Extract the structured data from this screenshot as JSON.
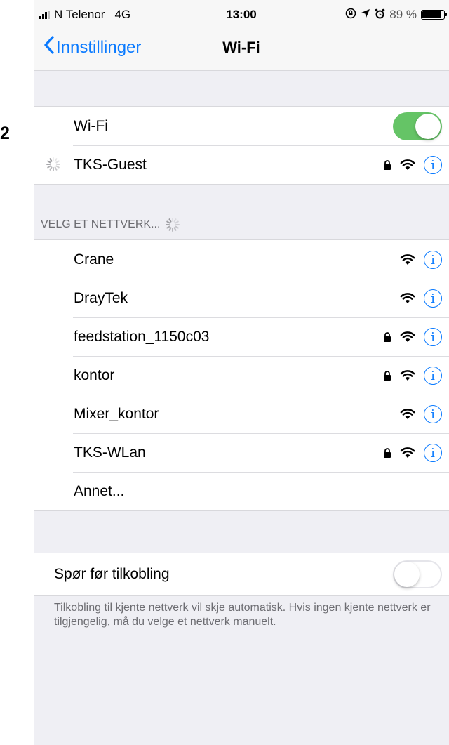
{
  "step_number": "2",
  "status_bar": {
    "carrier": "N Telenor",
    "network": "4G",
    "time": "13:00",
    "battery_text": "89 %",
    "battery_level": 0.89
  },
  "nav": {
    "back_label": "Innstillinger",
    "title": "Wi-Fi"
  },
  "wifi_toggle": {
    "label": "Wi-Fi",
    "on": true
  },
  "connected_network": {
    "name": "TKS-Guest",
    "locked": true,
    "connecting": true
  },
  "section_header": "VELG ET NETTVERK...",
  "networks": [
    {
      "name": "Crane",
      "locked": false
    },
    {
      "name": "DrayTek",
      "locked": false
    },
    {
      "name": "feedstation_1150c03",
      "locked": true
    },
    {
      "name": "kontor",
      "locked": true
    },
    {
      "name": "Mixer_kontor",
      "locked": false
    },
    {
      "name": "TKS-WLan",
      "locked": true
    }
  ],
  "other_label": "Annet...",
  "ask_to_join": {
    "label": "Spør før tilkobling",
    "on": false
  },
  "footer_note": "Tilkobling til kjente nettverk vil skje automatisk. Hvis ingen kjente nettverk er tilgjengelig, må du velge et nettverk manuelt.",
  "colors": {
    "accent": "#0a7aff",
    "toggle_on": "#65c466",
    "background": "#efeff4"
  },
  "icons": [
    "signal-icon",
    "alarm-lock-icon",
    "location-icon",
    "alarm-clock-icon",
    "battery-icon",
    "chevron-left-icon",
    "lock-icon",
    "wifi-icon",
    "info-icon",
    "spinner-icon"
  ]
}
